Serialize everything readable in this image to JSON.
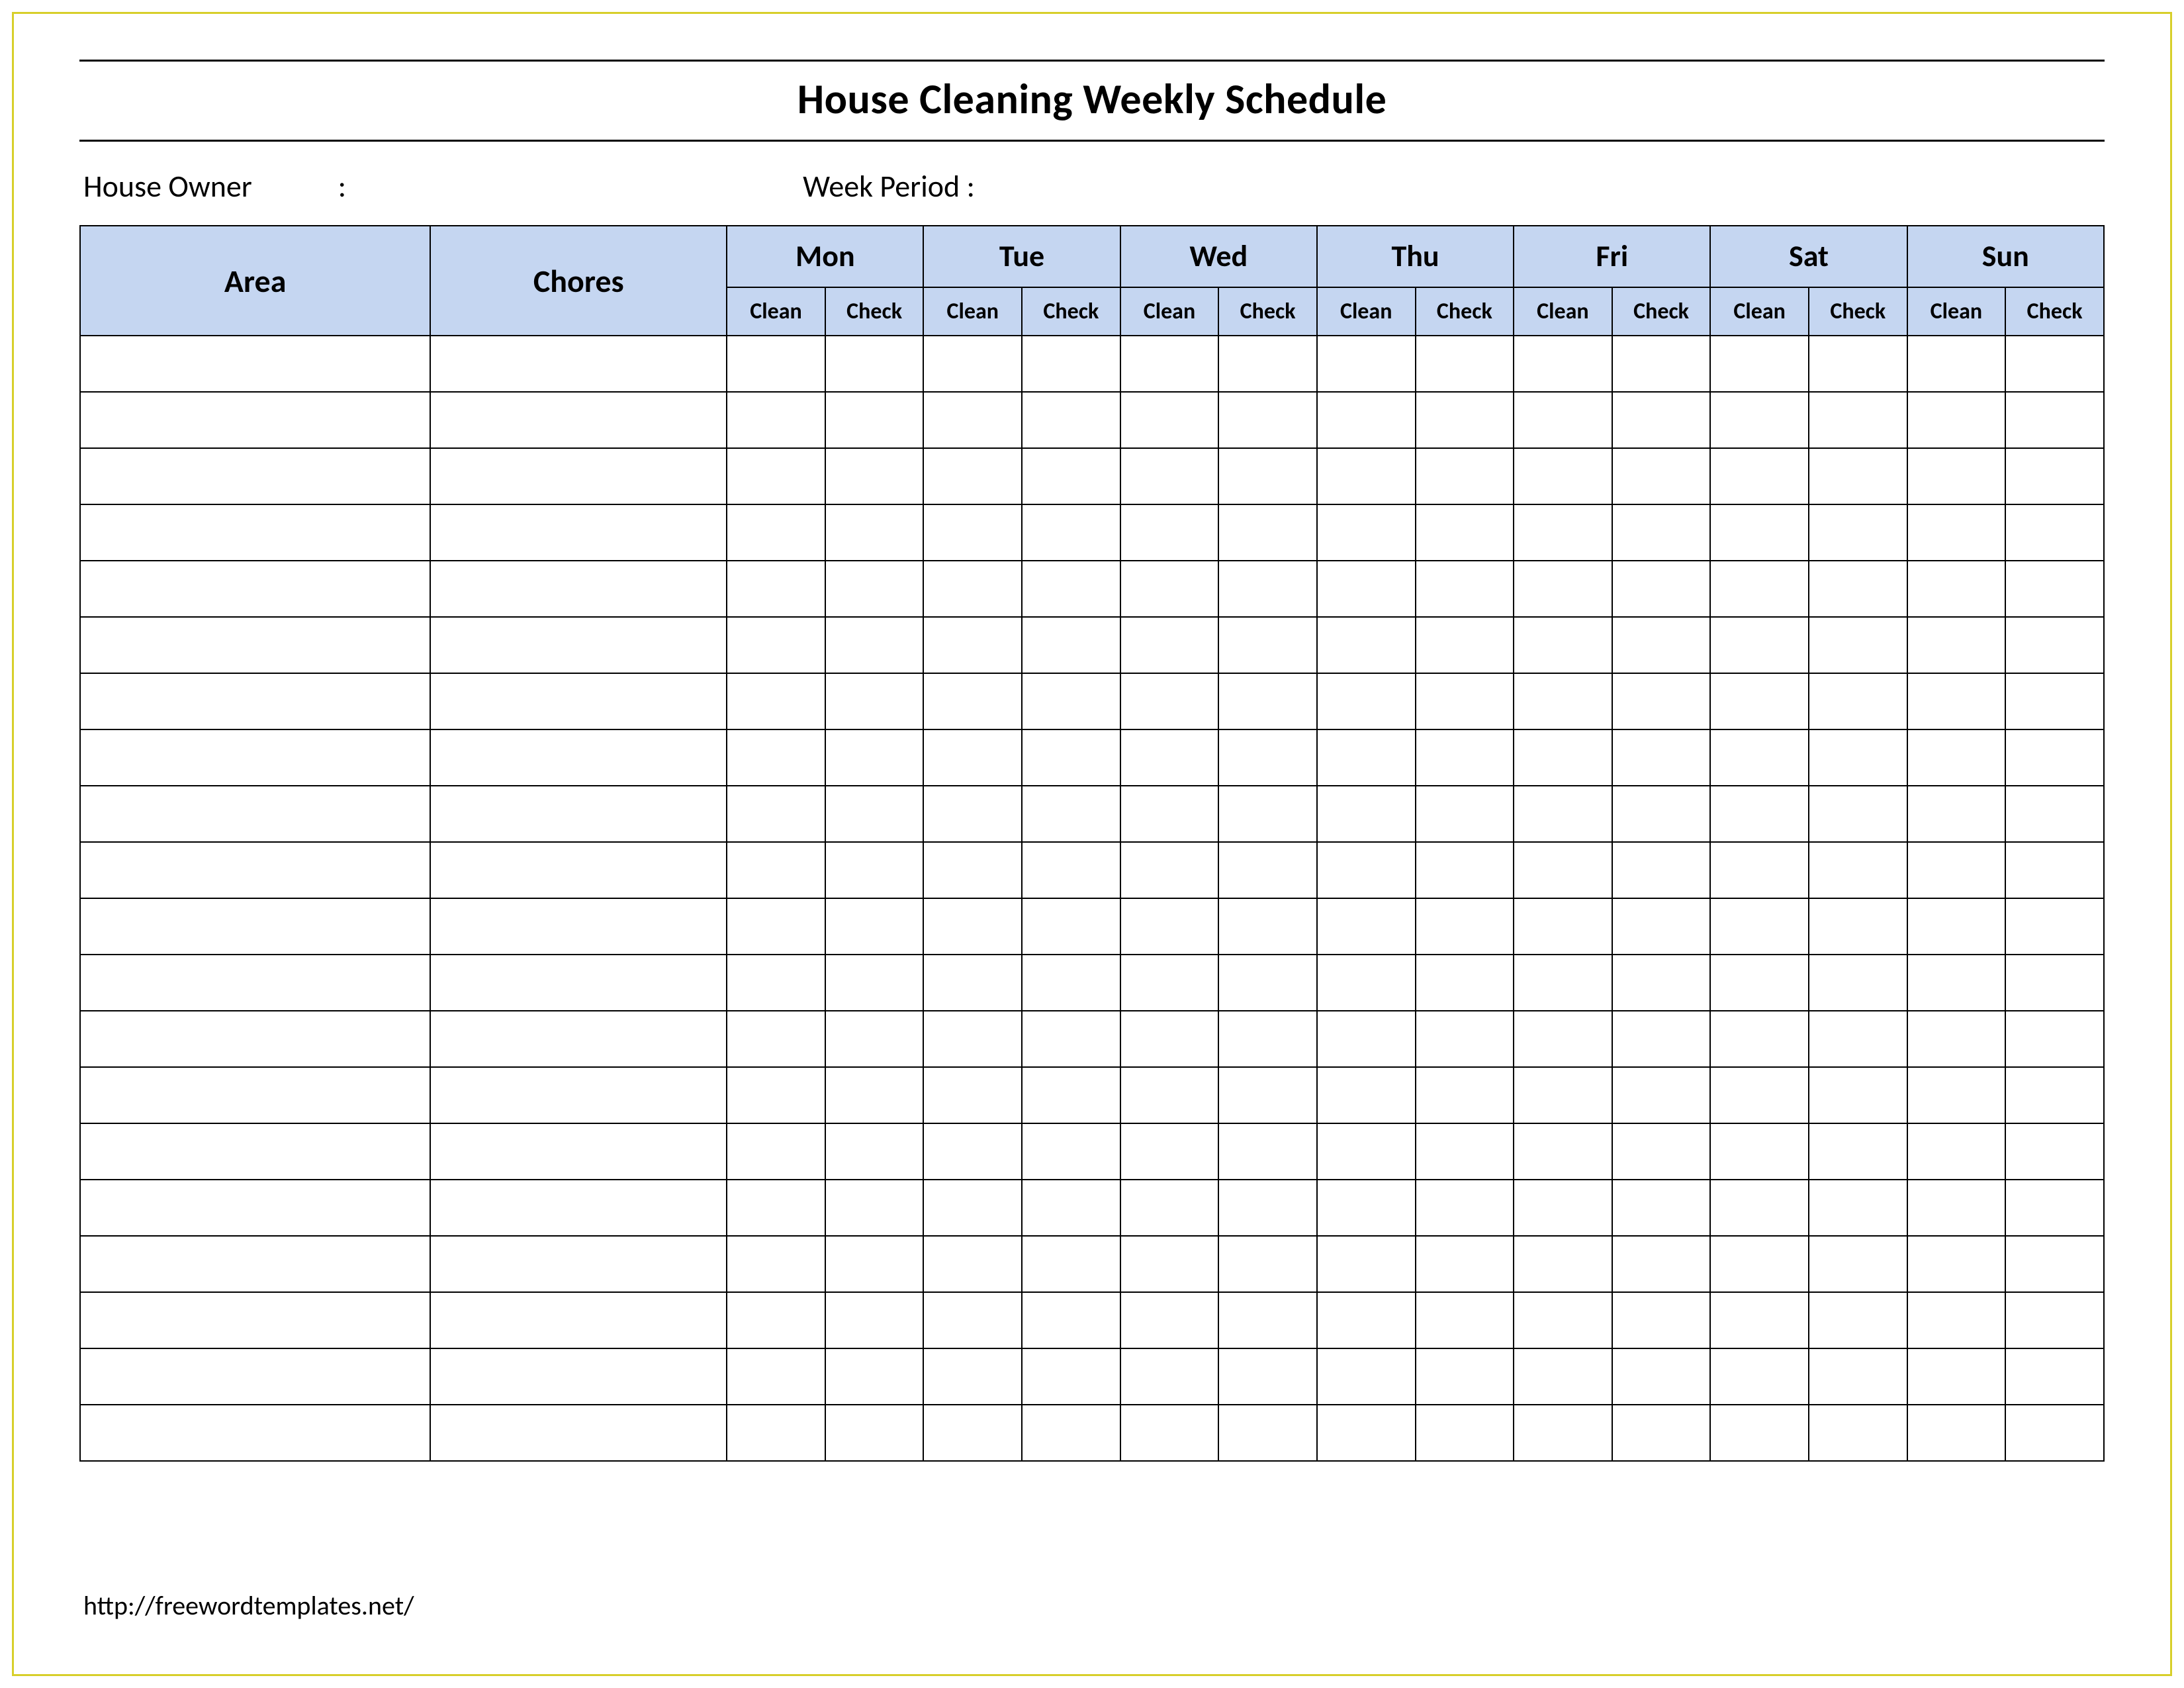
{
  "title": "House Cleaning Weekly Schedule",
  "meta": {
    "owner_label": "House Owner",
    "owner_value": "",
    "colon": ":",
    "week_label": "Week  Period :",
    "week_value": ""
  },
  "headers": {
    "area": "Area",
    "chores": "Chores",
    "days": [
      "Mon",
      "Tue",
      "Wed",
      "Thu",
      "Fri",
      "Sat",
      "Sun"
    ],
    "sub": {
      "clean": "Clean",
      "check": "Check"
    }
  },
  "row_count": 20,
  "footer_url": "http://freewordtemplates.net/"
}
